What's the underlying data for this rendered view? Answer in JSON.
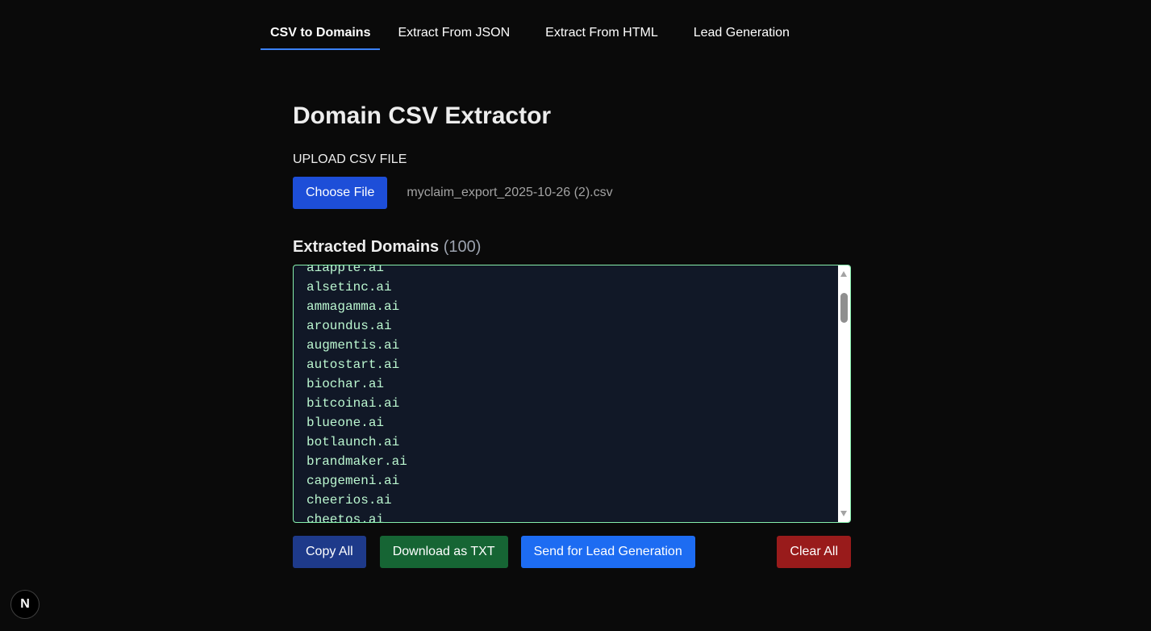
{
  "tabs": [
    {
      "label": "CSV to Domains",
      "active": true
    },
    {
      "label": "Extract From JSON",
      "active": false
    },
    {
      "label": "Extract From HTML",
      "active": false
    },
    {
      "label": "Lead Generation",
      "active": false
    }
  ],
  "main": {
    "title": "Domain CSV Extractor",
    "upload_label": "UPLOAD CSV FILE",
    "choose_file_label": "Choose File",
    "file_name": "myclaim_export_2025-10-26 (2).csv",
    "extracted_title": "Extracted Domains",
    "extracted_count": "(100)"
  },
  "domains": [
    "aiapple.ai",
    "alsetinc.ai",
    "ammagamma.ai",
    "aroundus.ai",
    "augmentis.ai",
    "autostart.ai",
    "biochar.ai",
    "bitcoinai.ai",
    "blueone.ai",
    "botlaunch.ai",
    "brandmaker.ai",
    "capgemeni.ai",
    "cheerios.ai",
    "cheetos.ai"
  ],
  "actions": {
    "copy_all": "Copy All",
    "download_txt": "Download as TXT",
    "send_lead": "Send for Lead Generation",
    "clear_all": "Clear All"
  },
  "next_badge": "N",
  "colors": {
    "background": "#0a0a0a",
    "tab_underline": "#3b82f6",
    "choose_file": "#1d4ed8",
    "copy_all": "#1e3a8a",
    "download": "#166534",
    "send": "#1d6cf2",
    "clear": "#991b1b",
    "domain_text": "#bbf7d0",
    "list_border": "#86efac"
  }
}
